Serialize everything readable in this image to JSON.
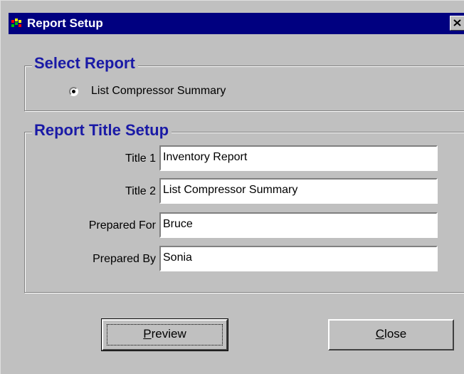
{
  "window": {
    "title": "Report Setup",
    "close_glyph": "✕",
    "icon": "report-app-icon"
  },
  "select_report": {
    "legend": "Select Report",
    "option_label": "List Compressor Summary",
    "option_selected": true
  },
  "title_setup": {
    "legend": "Report Title Setup",
    "fields": {
      "title1": {
        "label": "Title 1",
        "value": "Inventory Report"
      },
      "title2": {
        "label": "Title 2",
        "value": "List Compressor Summary"
      },
      "prepared_for": {
        "label": "Prepared For",
        "value": "Bruce"
      },
      "prepared_by": {
        "label": "Prepared By",
        "value": "Sonia"
      }
    }
  },
  "buttons": {
    "preview_first": "P",
    "preview_rest": "review",
    "close_first": "C",
    "close_rest": "lose"
  },
  "colors": {
    "titlebar": "#000080",
    "legend_text": "#1a1aa6",
    "dialog_bg": "#c0c0c0"
  }
}
